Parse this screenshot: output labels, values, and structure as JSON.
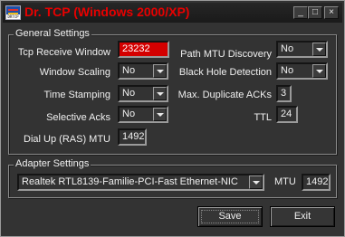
{
  "window": {
    "title": "Dr. TCP (Windows 2000/XP)",
    "icon_text": "DRTCP",
    "minimize_glyph": "_",
    "maximize_glyph": "□",
    "close_glyph": "×"
  },
  "general": {
    "title": "General Settings",
    "tcp_receive_window": {
      "label": "Tcp Receive Window",
      "value": "23232"
    },
    "window_scaling": {
      "label": "Window Scaling",
      "value": "No"
    },
    "time_stamping": {
      "label": "Time Stamping",
      "value": "No"
    },
    "selective_acks": {
      "label": "Selective Acks",
      "value": "No"
    },
    "dial_up_mtu": {
      "label": "Dial Up (RAS) MTU",
      "value": "1492"
    },
    "path_mtu_discovery": {
      "label": "Path MTU Discovery",
      "value": "No"
    },
    "black_hole_detection": {
      "label": "Black Hole Detection",
      "value": "No"
    },
    "max_duplicate_acks": {
      "label": "Max. Duplicate ACKs",
      "value": "3"
    },
    "ttl": {
      "label": "TTL",
      "value": "24"
    }
  },
  "adapter": {
    "title": "Adapter Settings",
    "selected": "Realtek RTL8139-Familie-PCI-Fast Ethernet-NIC",
    "mtu_label": "MTU",
    "mtu_value": "1492"
  },
  "buttons": {
    "save": "Save",
    "exit": "Exit"
  }
}
